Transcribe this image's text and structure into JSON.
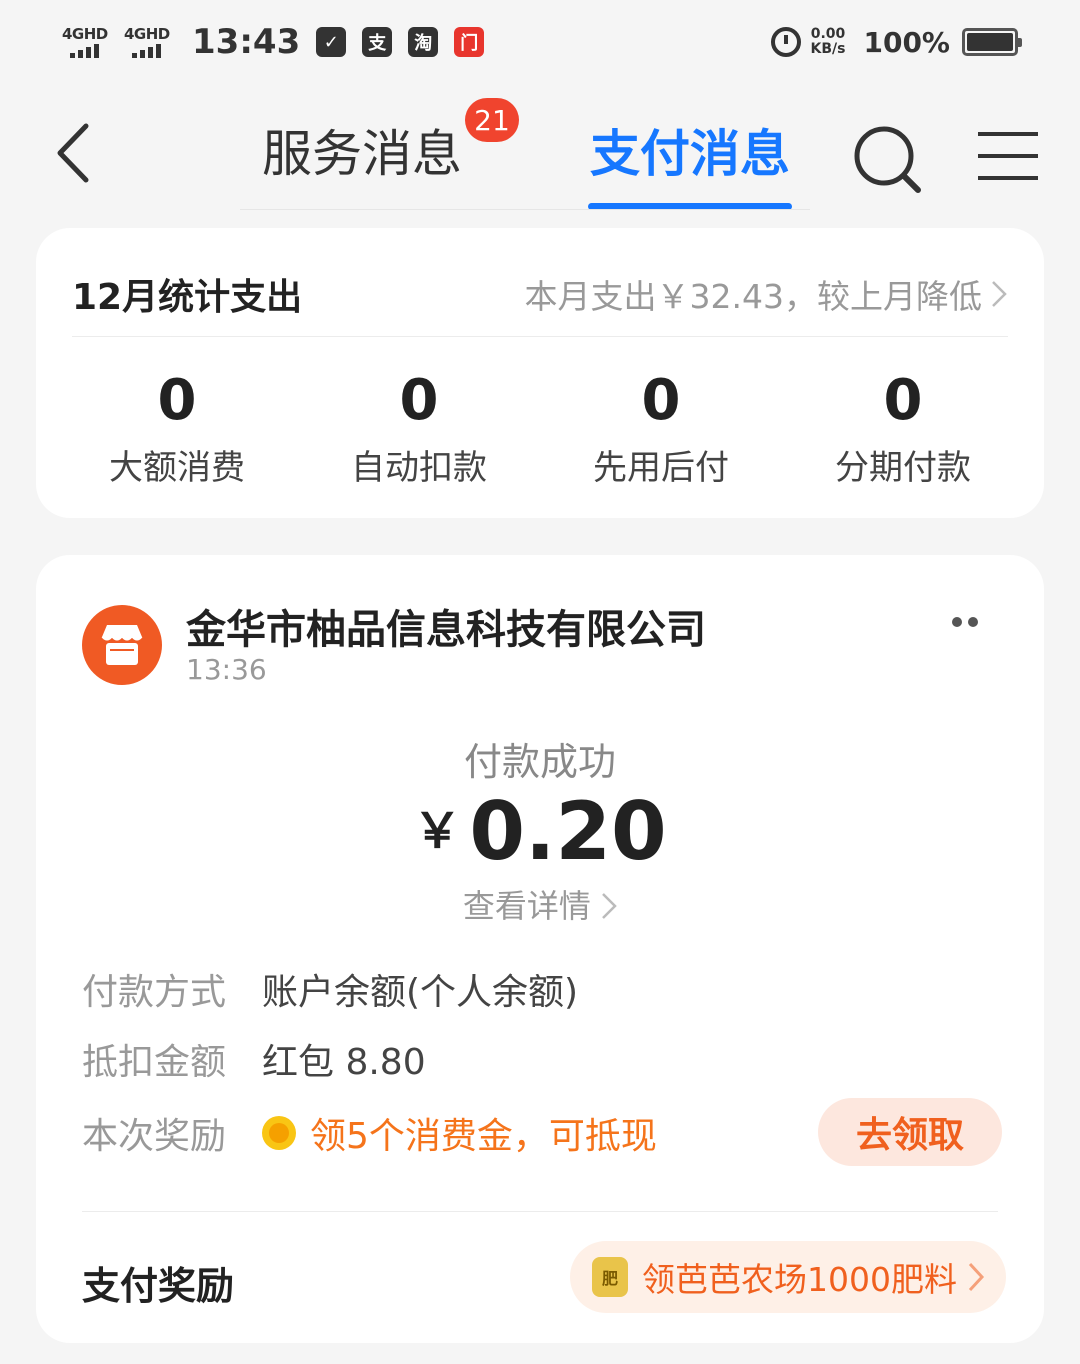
{
  "status_bar": {
    "signal1": "4GHD",
    "signal2": "4GHD",
    "time": "13:43",
    "apps": [
      {
        "name": "check",
        "glyph": "✓",
        "color": "#333333"
      },
      {
        "name": "alipay",
        "glyph": "支",
        "color": "#333333"
      },
      {
        "name": "taobao",
        "glyph": "淘",
        "color": "#333333"
      },
      {
        "name": "news",
        "glyph": "门",
        "color": "#e8352d"
      }
    ],
    "net_speed": "0.00",
    "net_unit": "KB/s",
    "battery": "100%"
  },
  "nav": {
    "tab_service": "服务消息",
    "tab_service_badge": "21",
    "tab_pay": "支付消息",
    "accent_color": "#1677ff"
  },
  "stats": {
    "title": "12月统计支出",
    "summary": "本月支出￥32.43，较上月降低",
    "items": [
      {
        "value": "0",
        "label": "大额消费"
      },
      {
        "value": "0",
        "label": "自动扣款"
      },
      {
        "value": "0",
        "label": "先用后付"
      },
      {
        "value": "0",
        "label": "分期付款"
      }
    ]
  },
  "message": {
    "merchant": "金华市柚品信息科技有限公司",
    "time": "13:36",
    "status": "付款成功",
    "currency": "￥",
    "amount": "0.20",
    "detail_link": "查看详情",
    "method_label": "付款方式",
    "method_value": "账户余额(个人余额)",
    "deduct_label": "抵扣金额",
    "deduct_value": "红包 8.80",
    "reward_label": "本次奖励",
    "reward_value": "领5个消费金，可抵现",
    "claim_button": "去领取",
    "pay_reward_title": "支付奖励",
    "fertilizer_icon": "肥",
    "farm_link": "领芭芭农场1000肥料",
    "accent_orange": "#f0601e"
  }
}
